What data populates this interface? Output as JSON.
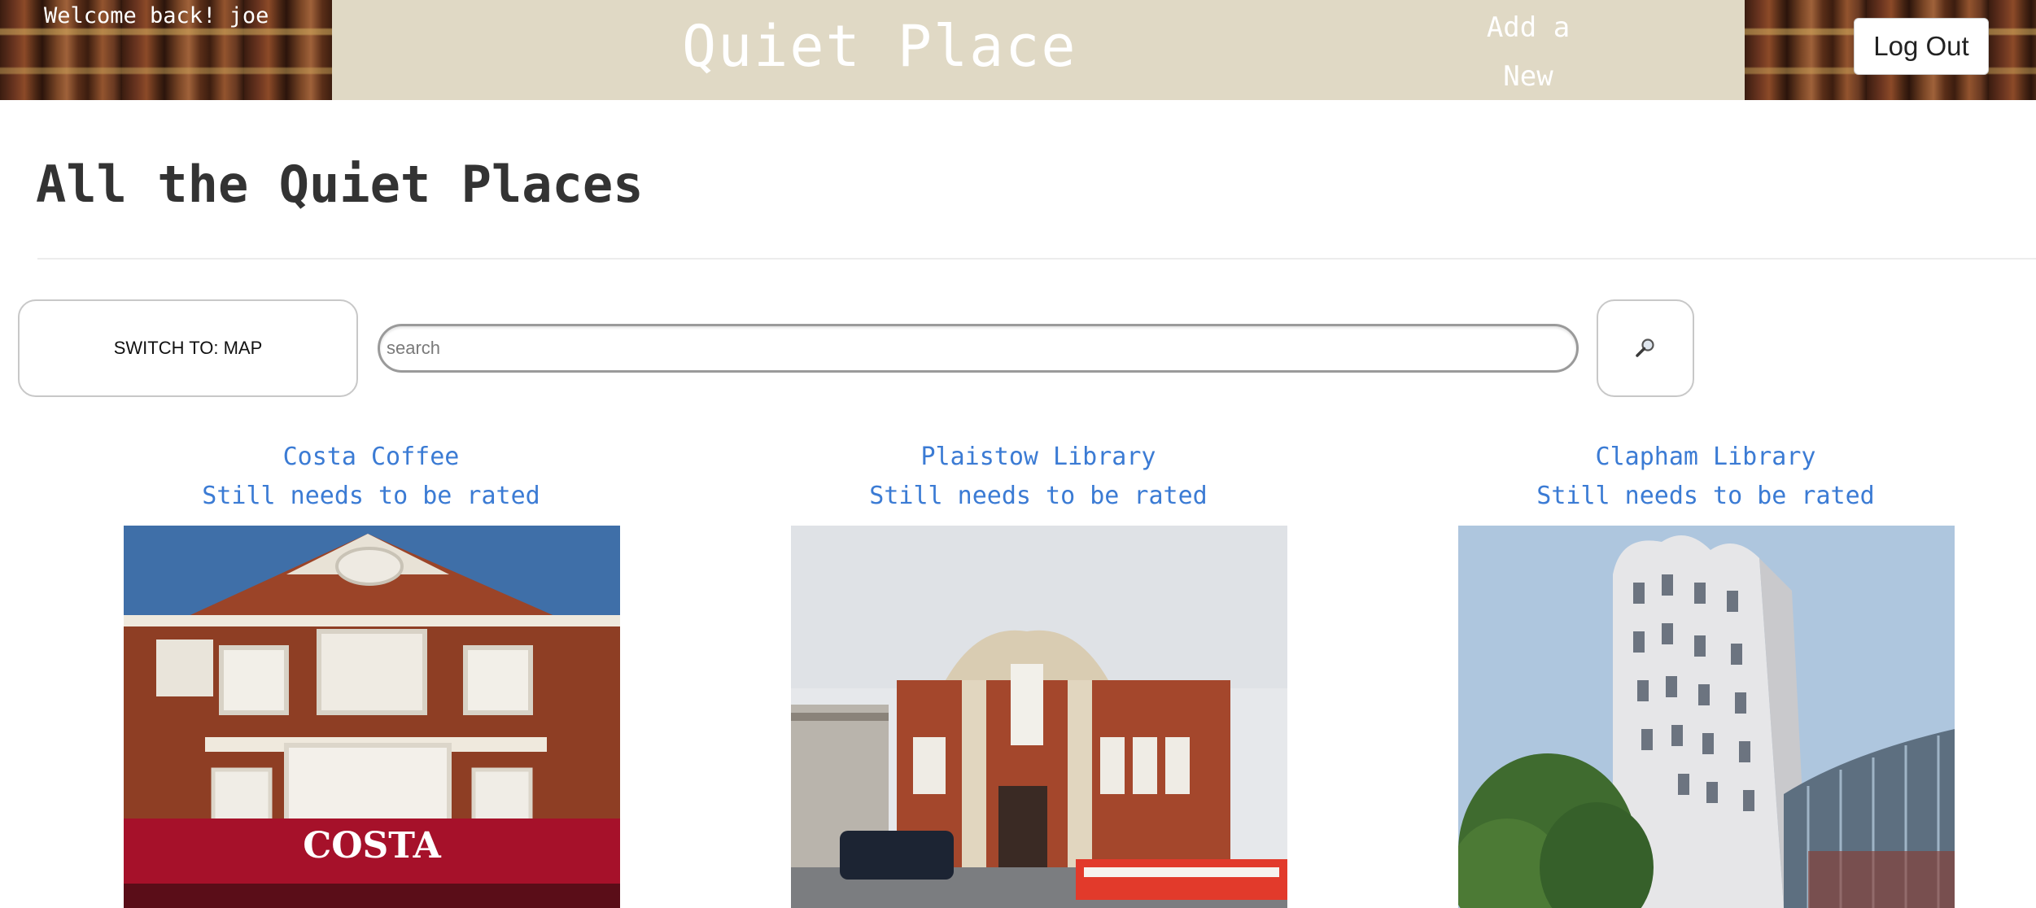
{
  "header": {
    "welcome_text": "Welcome back! joe",
    "site_title": "Quiet Place",
    "add_new_label": "Add a New",
    "logout_label": "Log Out",
    "accent_color": "#e0d9c5"
  },
  "page": {
    "title": "All the Quiet Places"
  },
  "toolbar": {
    "switch_label": "SWITCH TO: MAP",
    "search_placeholder": "search",
    "search_value": "",
    "search_icon": "magnifier-icon"
  },
  "places": [
    {
      "name": "Costa Coffee",
      "rating": "Still needs to be rated",
      "photo": "costa-coffee-building-photo"
    },
    {
      "name": "Plaistow Library",
      "rating": "Still needs to be rated",
      "photo": "plaistow-library-building-photo"
    },
    {
      "name": "Clapham Library",
      "rating": "Still needs to be rated",
      "photo": "clapham-library-building-photo"
    }
  ],
  "colors": {
    "link": "#3b7bd4",
    "header_band": "#e0d9c5",
    "heading_text": "#333333"
  }
}
